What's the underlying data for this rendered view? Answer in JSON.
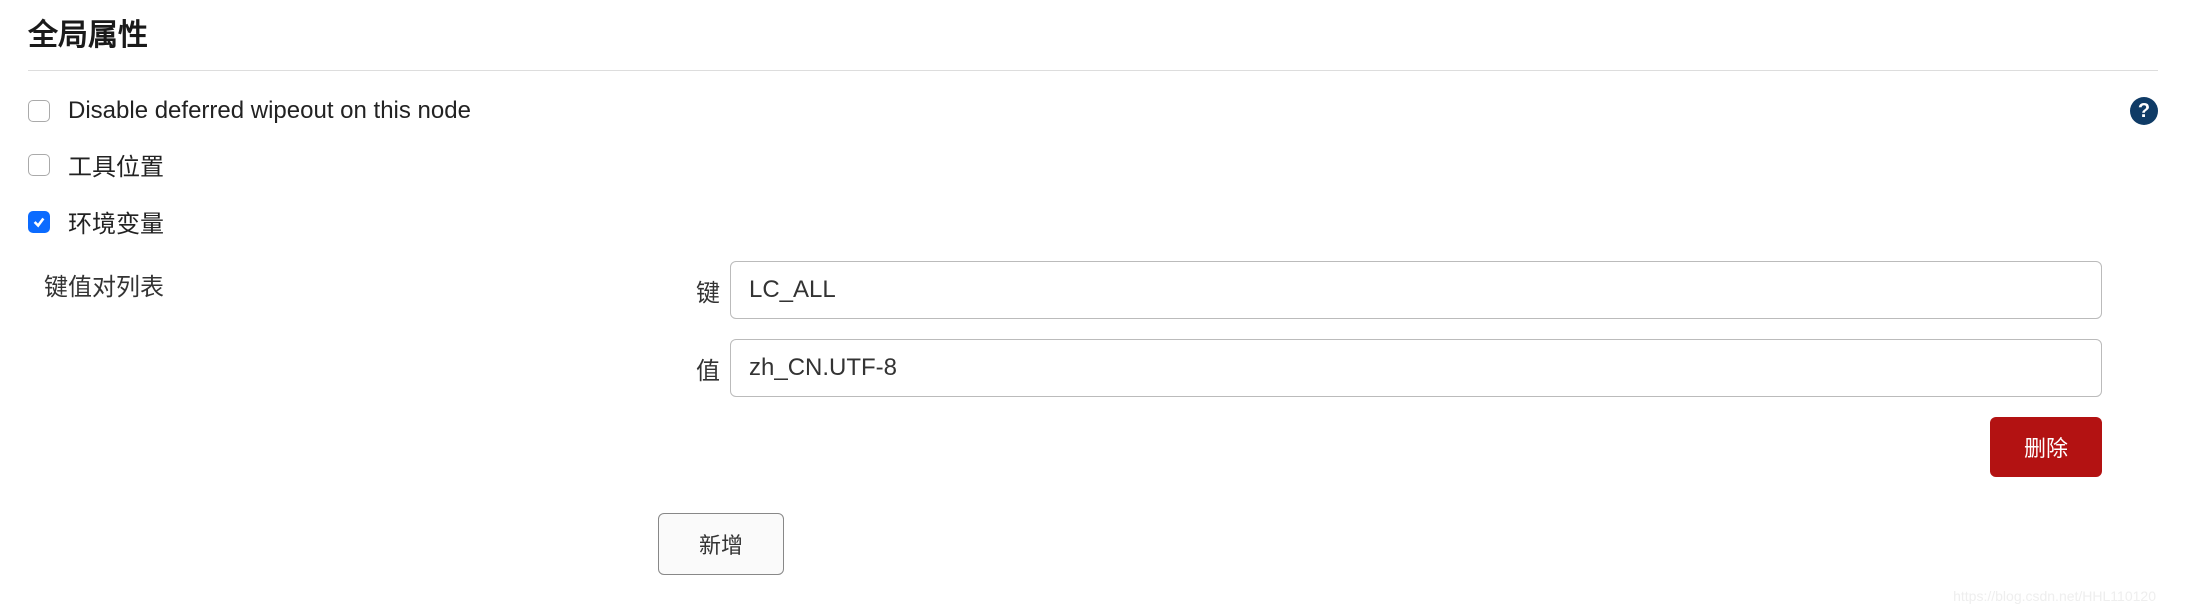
{
  "section": {
    "title": "全局属性"
  },
  "options": {
    "disable_wipeout": {
      "label": "Disable deferred wipeout on this node",
      "checked": false
    },
    "tool_location": {
      "label": "工具位置",
      "checked": false
    },
    "env_vars": {
      "label": "环境变量",
      "checked": true
    }
  },
  "kv": {
    "list_label": "键值对列表",
    "key_label": "键",
    "value_label": "值",
    "entries": [
      {
        "key": "LC_ALL",
        "value": "zh_CN.UTF-8"
      }
    ]
  },
  "buttons": {
    "delete": "删除",
    "add": "新增"
  },
  "help": {
    "glyph": "?"
  },
  "watermark": "https://blog.csdn.net/HHL110120"
}
